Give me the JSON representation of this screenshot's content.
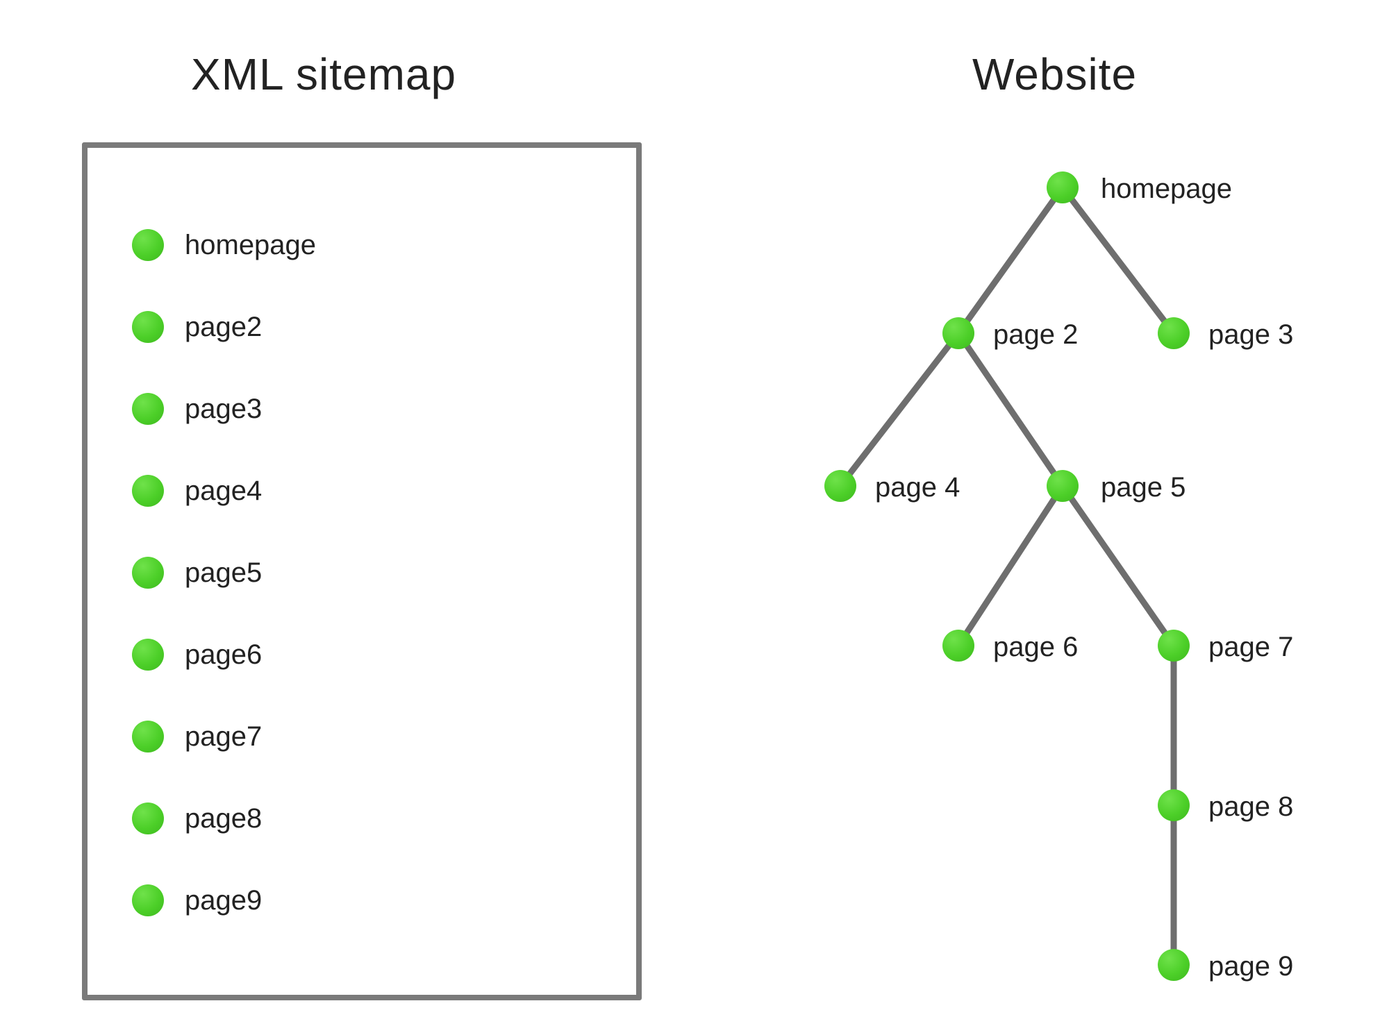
{
  "titles": {
    "sitemap": "XML sitemap",
    "website": "Website"
  },
  "sitemap": {
    "items": [
      {
        "label": "homepage"
      },
      {
        "label": "page2"
      },
      {
        "label": "page3"
      },
      {
        "label": "page4"
      },
      {
        "label": "page5"
      },
      {
        "label": "page6"
      },
      {
        "label": "page7"
      },
      {
        "label": "page8"
      },
      {
        "label": "page9"
      }
    ]
  },
  "tree": {
    "nodes": {
      "homepage": {
        "label": "homepage"
      },
      "page2": {
        "label": "page 2"
      },
      "page3": {
        "label": "page 3"
      },
      "page4": {
        "label": "page 4"
      },
      "page5": {
        "label": "page 5"
      },
      "page6": {
        "label": "page 6"
      },
      "page7": {
        "label": "page 7"
      },
      "page8": {
        "label": "page 8"
      },
      "page9": {
        "label": "page 9"
      }
    },
    "edges": [
      [
        "homepage",
        "page2"
      ],
      [
        "homepage",
        "page3"
      ],
      [
        "page2",
        "page4"
      ],
      [
        "page2",
        "page5"
      ],
      [
        "page5",
        "page6"
      ],
      [
        "page5",
        "page7"
      ],
      [
        "page7",
        "page8"
      ],
      [
        "page8",
        "page9"
      ]
    ]
  }
}
